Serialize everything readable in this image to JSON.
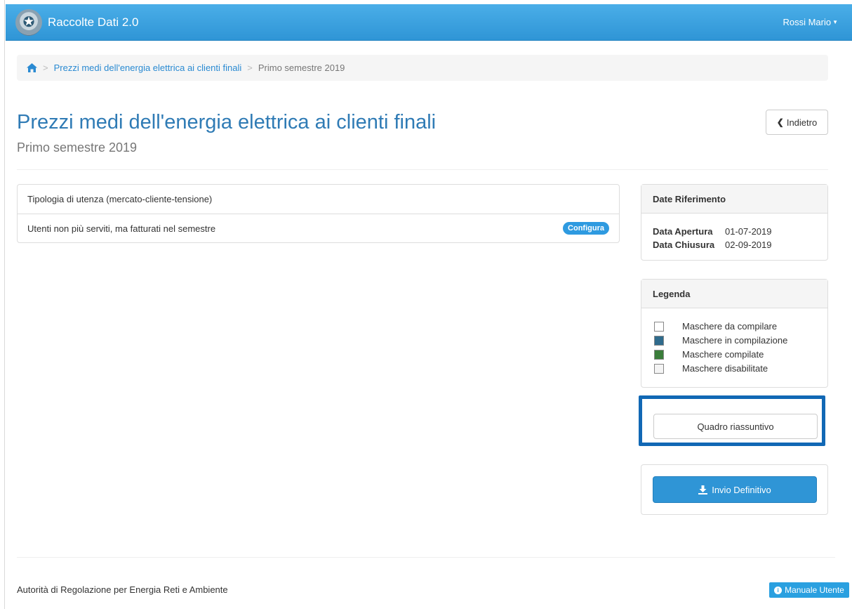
{
  "navbar": {
    "brand": "Raccolte Dati 2.0",
    "user": "Rossi Mario"
  },
  "breadcrumb": {
    "home_icon": "home-icon",
    "parent": "Prezzi medi dell'energia elettrica ai clienti finali",
    "current": "Primo semestre 2019",
    "separator": ">"
  },
  "header": {
    "title": "Prezzi medi dell'energia elettrica ai clienti finali",
    "subtitle": "Primo semestre 2019",
    "back_label": "Indietro"
  },
  "list": {
    "rows": [
      {
        "label": "Tipologia di utenza (mercato-cliente-tensione)",
        "badge": ""
      },
      {
        "label": "Utenti non più serviti, ma fatturati nel semestre",
        "badge": "Configura"
      }
    ]
  },
  "dates": {
    "heading": "Date Riferimento",
    "opening_label": "Data Apertura",
    "opening_value": "01-07-2019",
    "closing_label": "Data Chiusura",
    "closing_value": "02-09-2019"
  },
  "legend": {
    "heading": "Legenda",
    "items": [
      {
        "label": "Maschere da compilare",
        "color": "#ffffff"
      },
      {
        "label": "Maschere in compilazione",
        "color": "#2f6b8c"
      },
      {
        "label": "Maschere compilate",
        "color": "#3a7d3a"
      },
      {
        "label": "Maschere disabilitate",
        "color": "#f4f4f4"
      }
    ]
  },
  "actions": {
    "summary_label": "Quadro riassuntivo",
    "send_label": "Invio Definitivo"
  },
  "footer": {
    "text": "Autorità di Regolazione per Energia Reti e Ambiente",
    "manual_label": "Manuale Utente"
  },
  "colors": {
    "navbar": "#3aa3e3",
    "link": "#2a8ad2",
    "title": "#2f7bb5",
    "primary_button": "#2f95d6",
    "highlight_border": "#1168b5"
  }
}
